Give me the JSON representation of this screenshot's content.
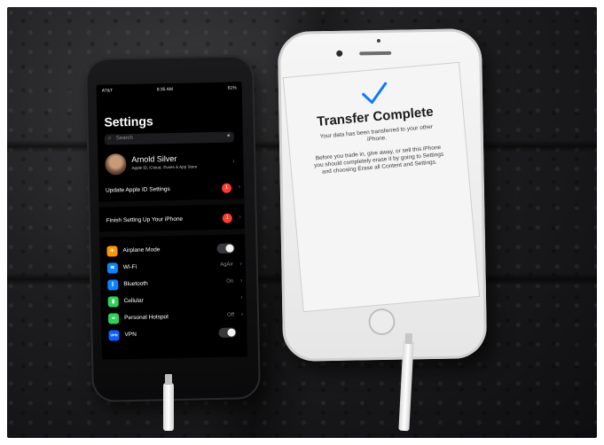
{
  "black_phone": {
    "status": {
      "carrier": "AT&T",
      "time": "8:35 AM",
      "battery": "61%"
    },
    "title": "Settings",
    "search_placeholder": "Search",
    "profile": {
      "name": "Arnold Silver",
      "subtitle": "Apple ID, iCloud, iTunes & App Store"
    },
    "update_apple_id": {
      "label": "Update Apple ID Settings",
      "badge": "1"
    },
    "finish_setup": {
      "label": "Finish Setting Up Your iPhone",
      "badge": "1"
    },
    "rows": {
      "airplane": {
        "label": "Airplane Mode",
        "color": "#ff9500",
        "glyph": "✈"
      },
      "wifi": {
        "label": "Wi-Fi",
        "value": "AgAir",
        "color": "#0a84ff",
        "glyph": "≋"
      },
      "bluetooth": {
        "label": "Bluetooth",
        "value": "On",
        "color": "#0a84ff",
        "glyph": "ᛒ"
      },
      "cellular": {
        "label": "Cellular",
        "color": "#30d158",
        "glyph": "▮"
      },
      "hotspot": {
        "label": "Personal Hotspot",
        "value": "Off",
        "color": "#30d158",
        "glyph": "∞"
      },
      "vpn": {
        "label": "VPN",
        "color": "#0a60ff",
        "glyph": "VPN"
      }
    }
  },
  "white_phone": {
    "title": "Transfer Complete",
    "message": "Your data has been transferred to your other iPhone.",
    "detail": "Before you trade in, give away, or sell this iPhone you should completely erase it by going to Settings and choosing Erase all Content and Settings."
  }
}
